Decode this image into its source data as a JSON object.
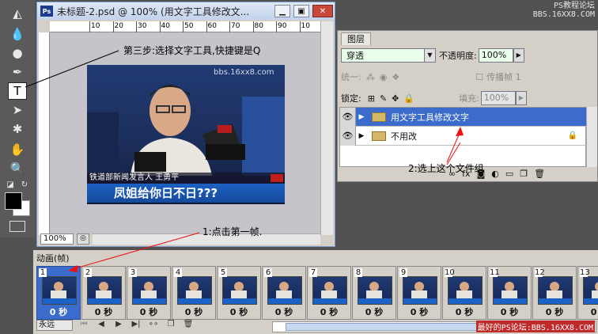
{
  "brand": {
    "top_line1": "PS教程论坛",
    "top_line2": "BBS.16XX8.COM",
    "bottom": "最好的PS论坛:BBS.16XX8.COM"
  },
  "tools": {
    "items": [
      "paint-bucket",
      "eyedropper",
      "burn",
      "pen",
      "type",
      "path-select",
      "shape",
      "hand",
      "zoom"
    ]
  },
  "document": {
    "title": "未标题-2.psd @ 100% (用文字工具修改文...",
    "zoom": "100%",
    "ruler_ticks": [
      "10",
      "20",
      "30",
      "40",
      "50",
      "60",
      "70",
      "80",
      "90",
      "10"
    ],
    "photo": {
      "watermark": "bbs.16xx8.com",
      "caption_small": "铁道部新闻发言人 王勇平",
      "caption_big": "凤姐给你日不日???"
    }
  },
  "layers_panel": {
    "tab": "图层",
    "blend_mode": "穿透",
    "opacity_label": "不透明度:",
    "opacity_value": "100%",
    "unify_label": "统一:",
    "propagate_label": "传播帧 1",
    "lock_label": "锁定:",
    "fill_label": "填充:",
    "fill_value": "100%",
    "layers": [
      {
        "name": "用文字工具修改文字",
        "active": true
      },
      {
        "name": "不用改",
        "active": false
      }
    ]
  },
  "animation_panel": {
    "tab": "动画(帧)",
    "loop": "永远",
    "frames": [
      {
        "num": "1",
        "delay": "0 秒"
      },
      {
        "num": "2",
        "delay": "0 秒"
      },
      {
        "num": "3",
        "delay": "0 秒"
      },
      {
        "num": "4",
        "delay": "0 秒"
      },
      {
        "num": "5",
        "delay": "0 秒"
      },
      {
        "num": "6",
        "delay": "0 秒"
      },
      {
        "num": "7",
        "delay": "0 秒"
      },
      {
        "num": "8",
        "delay": "0 秒"
      },
      {
        "num": "9",
        "delay": "0 秒"
      },
      {
        "num": "10",
        "delay": "0 秒"
      },
      {
        "num": "11",
        "delay": "0 秒"
      },
      {
        "num": "12",
        "delay": "0 秒"
      },
      {
        "num": "13",
        "delay": "0 秒"
      }
    ]
  },
  "annotations": {
    "step1": "1:点击第一帧.",
    "step2": "2:选上这个文件组",
    "step3": "第三步:选择文字工具,快捷键是Q"
  }
}
